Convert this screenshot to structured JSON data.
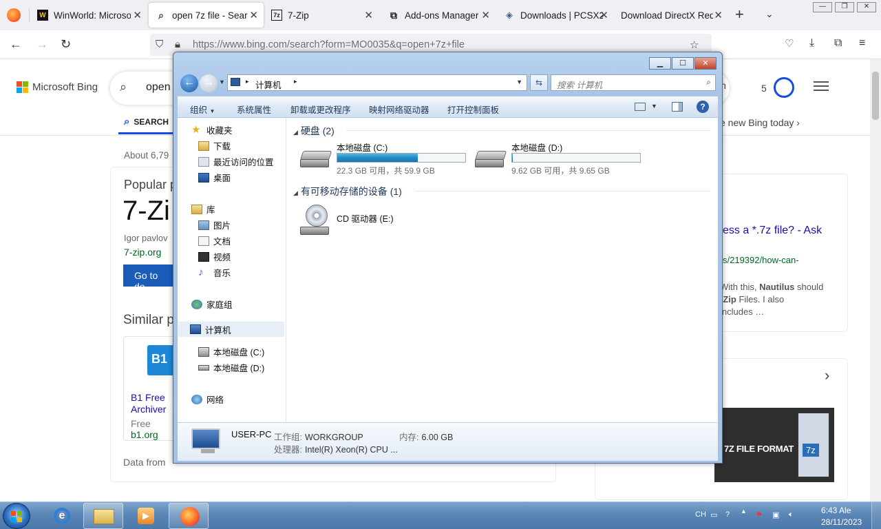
{
  "browser": {
    "tabs": [
      {
        "label": "WinWorld: Microso",
        "icon": "winworld-icon",
        "active": false
      },
      {
        "label": "open 7z file - Searc",
        "icon": "search-icon",
        "active": true
      },
      {
        "label": "7-Zip",
        "icon": "7zip-icon",
        "active": false
      },
      {
        "label": "Add-ons Manager",
        "icon": "puzzle-icon",
        "active": false
      },
      {
        "label": "Downloads | PCSX2",
        "icon": "pcsx2-icon",
        "active": false
      },
      {
        "label": "Download DirectX Redi",
        "icon": "",
        "active": false
      }
    ],
    "url": "https://www.bing.com/search?form=MO0035&q=open+7z+file"
  },
  "bing": {
    "logo_text": "Microsoft Bing",
    "query": "open",
    "signin": "in",
    "rewards_count": "5",
    "scope_search": "SEARCH",
    "promo": "e new Bing today",
    "results_count": "About 6,79",
    "popular_heading": "Popular p",
    "big_title": "7-Zi",
    "author": "Igor pavlov",
    "site": "7-zip.org",
    "goto_button": "Go to do",
    "similar_heading": "Similar p",
    "b1": {
      "name": "B1 Free Archiver",
      "price": "Free",
      "site": "b1.org",
      "logo": "B1"
    },
    "data_from": "Data from",
    "right_title": "ess a *.7z file? - Ask",
    "right_url": "s/219392/how-can-",
    "right_snip_1": "With this, ",
    "right_snip_bold": "Nautilus",
    "right_snip_2": " should",
    "right_snip_3": "-Zip",
    "right_snip_4": " Files. I also",
    "right_snip_5": "includes …",
    "thumb_text": "7Z FILE FORMAT",
    "thumb_badge": "7z"
  },
  "explorer": {
    "address_root_icon": "computer-icon",
    "address_path": "计算机",
    "search_placeholder": "搜索 计算机",
    "commands": {
      "organize": "组织",
      "system_properties": "系统属性",
      "uninstall": "卸载或更改程序",
      "map_drive": "映射网络驱动器",
      "control_panel": "打开控制面板"
    },
    "nav": {
      "favorites": "收藏夹",
      "downloads": "下载",
      "recent": "最近访问的位置",
      "desktop": "桌面",
      "libraries": "库",
      "pictures": "图片",
      "documents": "文档",
      "videos": "视频",
      "music": "音乐",
      "homegroup": "家庭组",
      "computer": "计算机",
      "drive_c": "本地磁盘 (C:)",
      "drive_d": "本地磁盘 (D:)",
      "network": "网络"
    },
    "groups": {
      "hard_disks": "硬盘 (2)",
      "removable": "有可移动存储的设备 (1)"
    },
    "drives": [
      {
        "name": "本地磁盘 (C:)",
        "free_text": "22.3 GB 可用，共 59.9 GB",
        "used_fraction": 0.628
      },
      {
        "name": "本地磁盘 (D:)",
        "free_text": "9.62 GB 可用，共 9.65 GB",
        "used_fraction": 0.003
      }
    ],
    "cd_drive": "CD 驱动器 (E:)",
    "details": {
      "computer_name": "USER-PC",
      "workgroup_label": "工作组:",
      "workgroup": "WORKGROUP",
      "memory_label": "内存:",
      "memory": "6.00 GB",
      "cpu_label": "处理器:",
      "cpu": "Intel(R) Xeon(R) CPU ..."
    }
  },
  "taskbar": {
    "lang": "CH",
    "time": "6:43 Ale",
    "date": "28/11/2023"
  },
  "colors": {
    "bing_blue": "#174ae4",
    "explorer_frame": "#a9c6e8",
    "taskbar": "#5a86b6",
    "drive_bar": "#238ac2"
  }
}
